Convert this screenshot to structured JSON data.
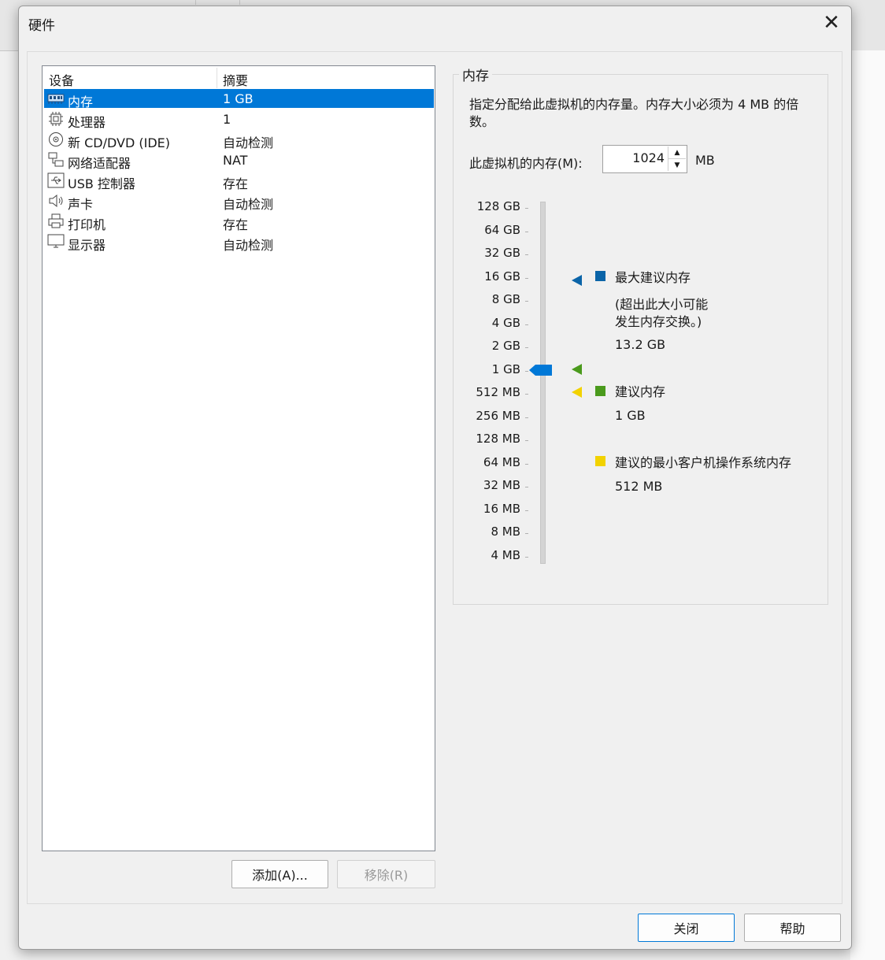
{
  "dialog": {
    "title": "硬件",
    "close_glyph": "✕"
  },
  "devices": {
    "header": {
      "device": "设备",
      "summary": "摘要"
    },
    "items": [
      {
        "name": "内存",
        "summary": "1 GB",
        "icon": "memory-icon",
        "selected": true
      },
      {
        "name": "处理器",
        "summary": "1",
        "icon": "cpu-icon"
      },
      {
        "name": "新 CD/DVD (IDE)",
        "summary": "自动检测",
        "icon": "cd-dvd-icon"
      },
      {
        "name": "网络适配器",
        "summary": "NAT",
        "icon": "network-adapter-icon"
      },
      {
        "name": "USB 控制器",
        "summary": "存在",
        "icon": "usb-icon"
      },
      {
        "name": "声卡",
        "summary": "自动检测",
        "icon": "speaker-icon"
      },
      {
        "name": "打印机",
        "summary": "存在",
        "icon": "printer-icon"
      },
      {
        "name": "显示器",
        "summary": "自动检测",
        "icon": "monitor-icon"
      }
    ],
    "add_label": "添加(A)...",
    "remove_label": "移除(R)"
  },
  "memory": {
    "group_title": "内存",
    "description": "指定分配给此虚拟机的内存量。内存大小必须为 4 MB 的倍数。",
    "field_label": "此虚拟机的内存(M):",
    "value": "1024",
    "unit": "MB",
    "scale": [
      "128 GB",
      "64 GB",
      "32 GB",
      "16 GB",
      "8 GB",
      "4 GB",
      "2 GB",
      "1 GB",
      "512 MB",
      "256 MB",
      "128 MB",
      "64 MB",
      "32 MB",
      "16 MB",
      "8 MB",
      "4 MB"
    ],
    "selected_scale": "1 GB",
    "legend": {
      "max_title": "最大建议内存",
      "max_note_line1": "(超出此大小可能",
      "max_note_line2": "发生内存交换。)",
      "max_value": "13.2 GB",
      "rec_title": "建议内存",
      "rec_value": "1 GB",
      "min_title": "建议的最小客户机操作系统内存",
      "min_value": "512 MB"
    },
    "colors": {
      "max": "#0a64a8",
      "recommended": "#4a9a1c",
      "minimum": "#f2d200",
      "thumb": "#0078d7"
    }
  },
  "footer": {
    "close_label": "关闭",
    "help_label": "帮助"
  }
}
